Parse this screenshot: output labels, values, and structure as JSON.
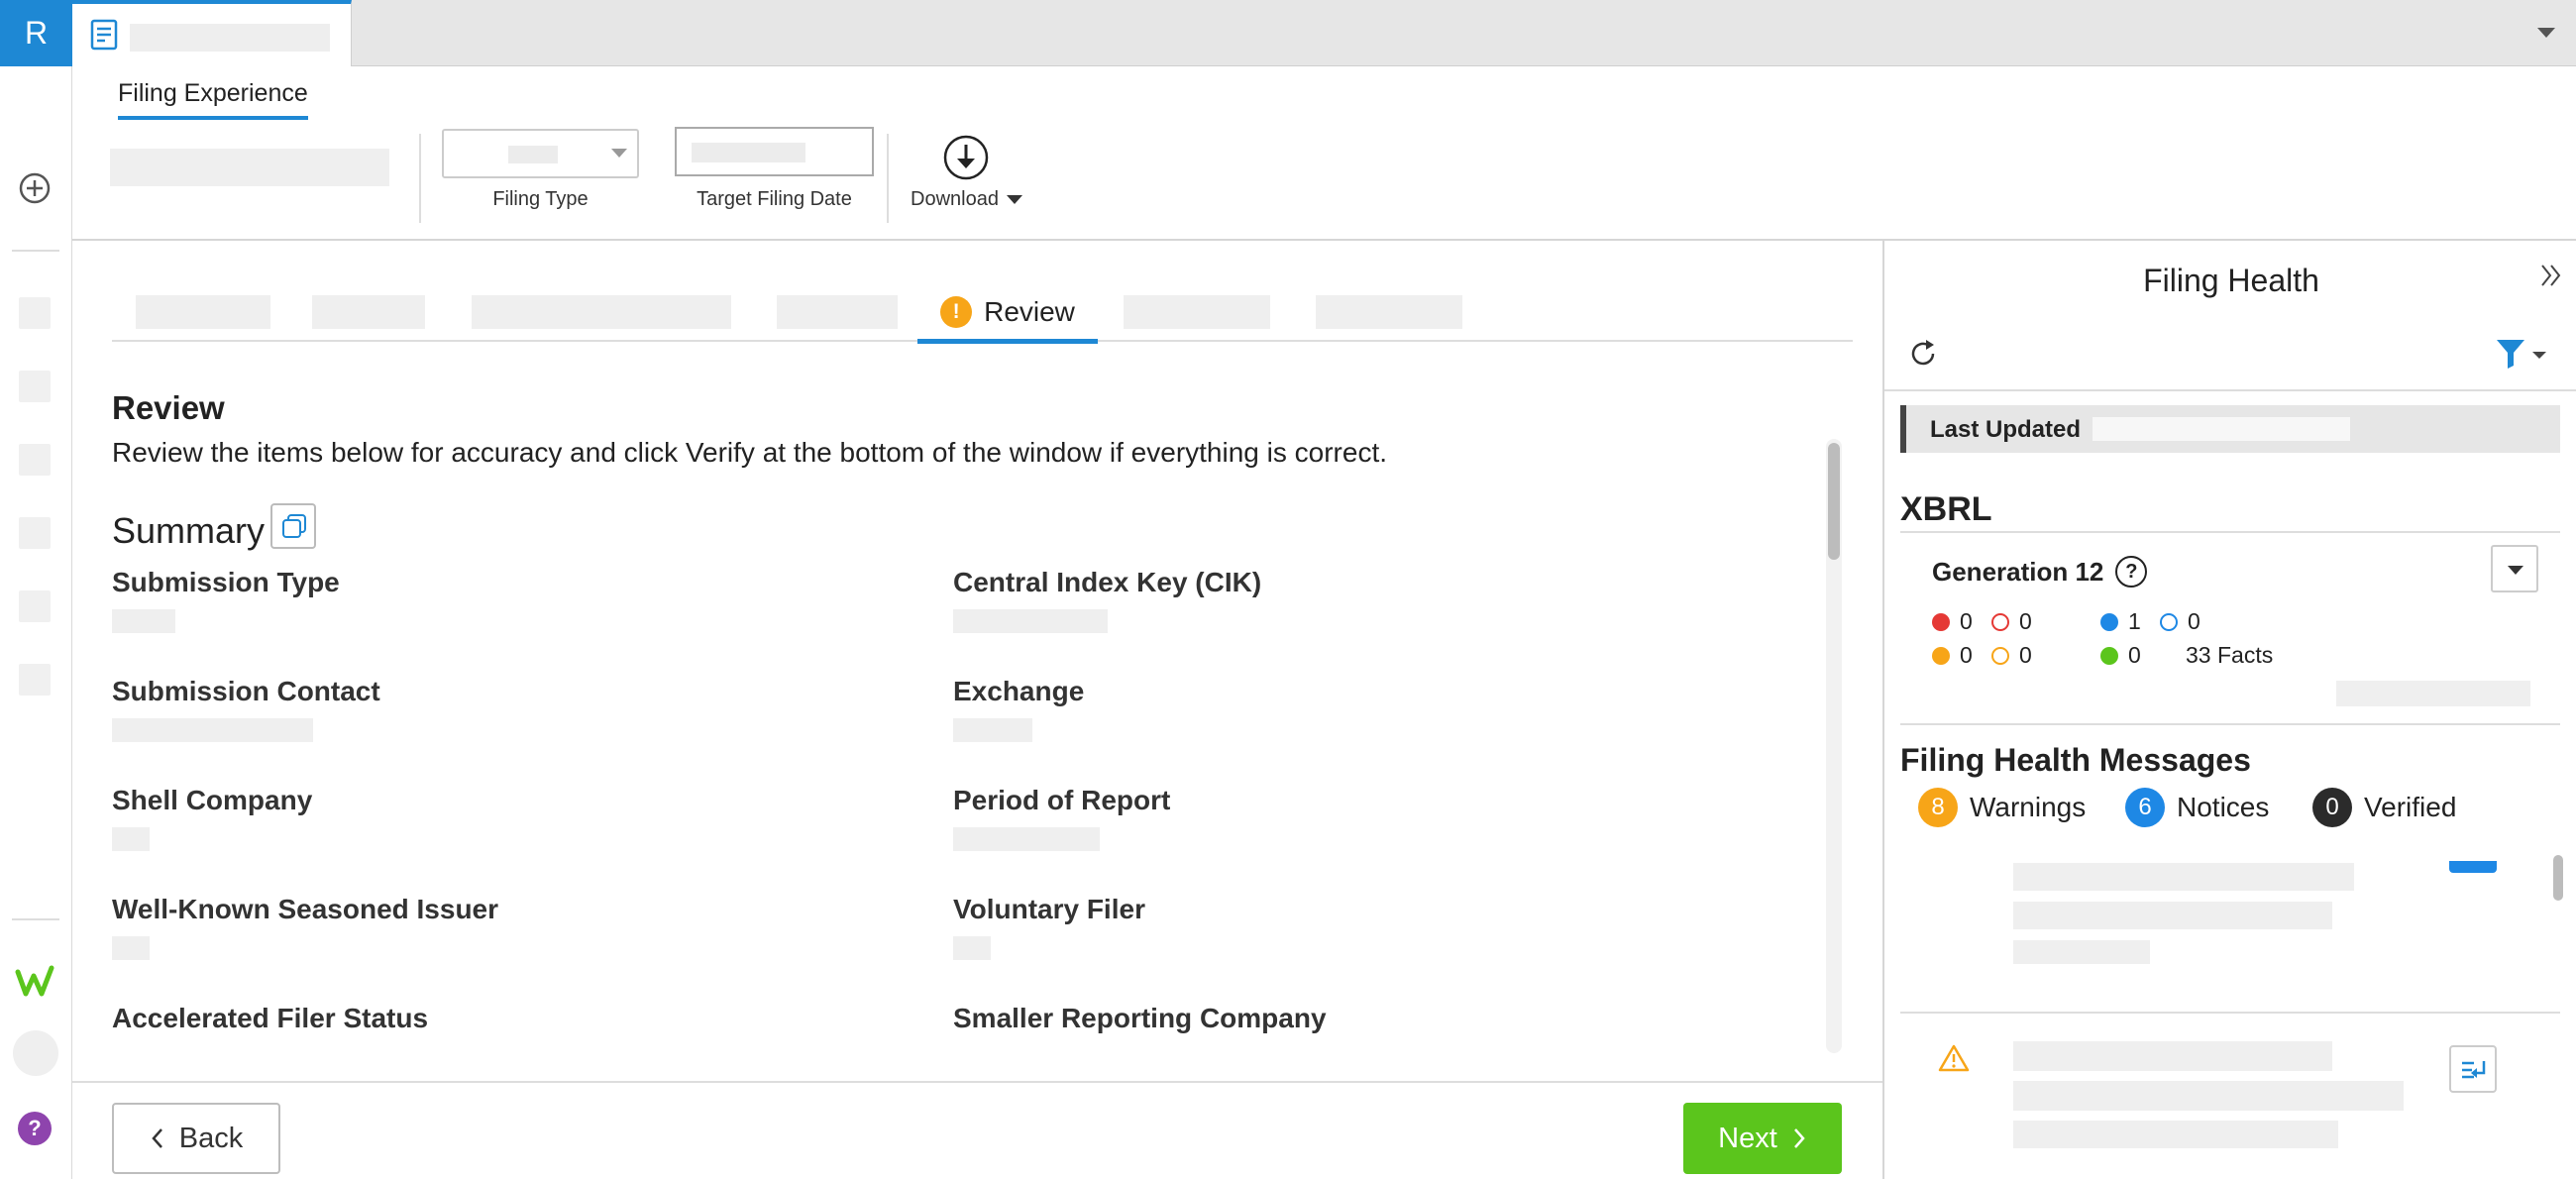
{
  "app": {
    "logo_letter": "R",
    "accent_color": "#1e88d4",
    "document_tab_icon": "document-icon"
  },
  "toolbar": {
    "active_tab": "Filing Experience",
    "filing_type_label": "Filing Type",
    "target_filing_date_label": "Target Filing Date",
    "download_label": "Download"
  },
  "steps": {
    "active_label": "Review",
    "active_status": "!"
  },
  "review": {
    "title": "Review",
    "description": "Review the items below for accuracy and click Verify at the bottom of the window if everything is correct.",
    "summary_title": "Summary",
    "fields": [
      {
        "label": "Submission Type"
      },
      {
        "label": "Central Index Key (CIK)"
      },
      {
        "label": "Submission Contact"
      },
      {
        "label": "Exchange"
      },
      {
        "label": "Shell Company"
      },
      {
        "label": "Period of Report"
      },
      {
        "label": "Well-Known Seasoned Issuer"
      },
      {
        "label": "Voluntary Filer"
      },
      {
        "label": "Accelerated Filer Status"
      },
      {
        "label": "Smaller Reporting Company"
      }
    ]
  },
  "footer": {
    "back_label": "Back",
    "next_label": "Next",
    "next_color": "#5bc51c"
  },
  "filing_health": {
    "title": "Filing Health",
    "last_updated_label": "Last Updated",
    "xbrl_title": "XBRL",
    "generation_label": "Generation 12",
    "help_glyph": "?",
    "counts": {
      "error_filled": "0",
      "error_outline": "0",
      "info_filled": "1",
      "info_outline": "0",
      "warning_filled": "0",
      "warning_outline": "0",
      "success_filled": "0",
      "facts": "33 Facts"
    },
    "messages_title": "Filing Health Messages",
    "badges": [
      {
        "count": "8",
        "label": "Warnings",
        "color": "#f7a518"
      },
      {
        "count": "6",
        "label": "Notices",
        "color": "#1e88e5"
      },
      {
        "count": "0",
        "label": "Verified",
        "color": "#2b2b2b"
      }
    ]
  }
}
